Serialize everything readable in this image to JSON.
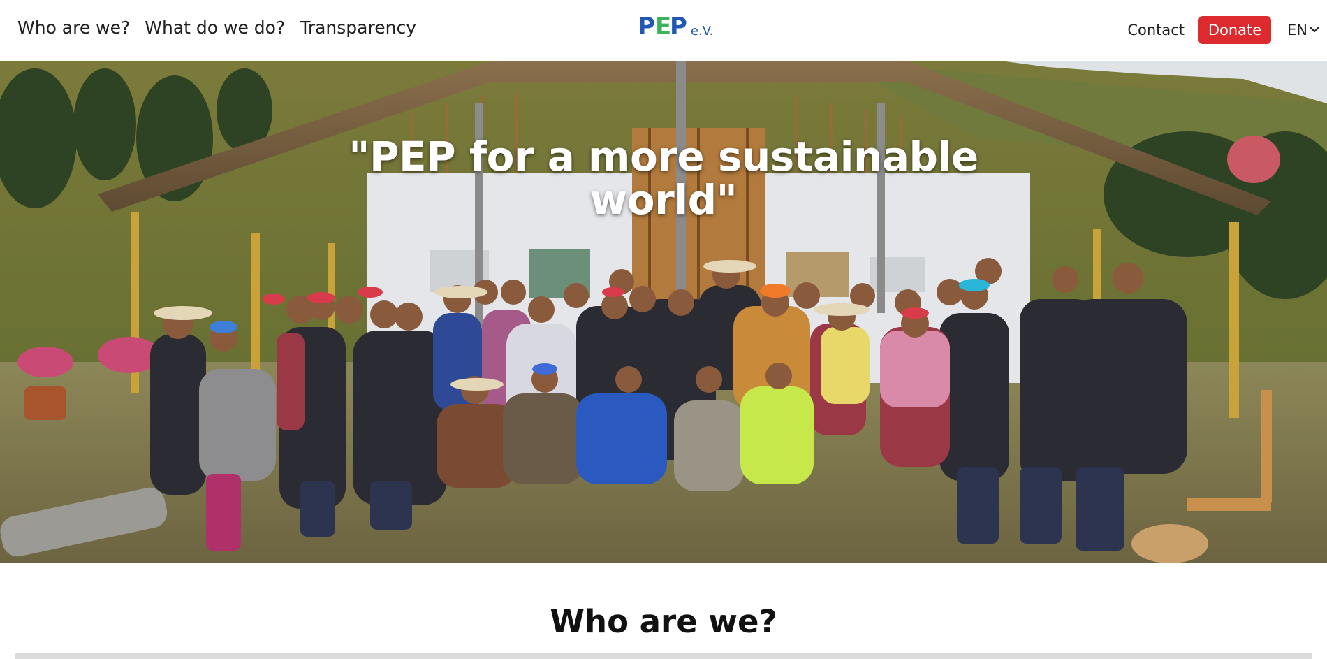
{
  "header": {
    "nav_left": [
      "Who are we?",
      "What do we do?",
      "Transparency"
    ],
    "brand": {
      "p1": "P",
      "e": "E",
      "p2": "P",
      "suffix": "e.V."
    },
    "contact_label": "Contact",
    "donate_label": "Donate",
    "language": "EN"
  },
  "hero": {
    "quote": "\"PEP for a more sustainable world\""
  },
  "section": {
    "title": "Who are we?"
  },
  "colors": {
    "brand_blue": "#2057b5",
    "brand_green": "#3cb35a",
    "donate_red": "#dc2a2e"
  },
  "icons": [
    "chevron-down-icon"
  ]
}
